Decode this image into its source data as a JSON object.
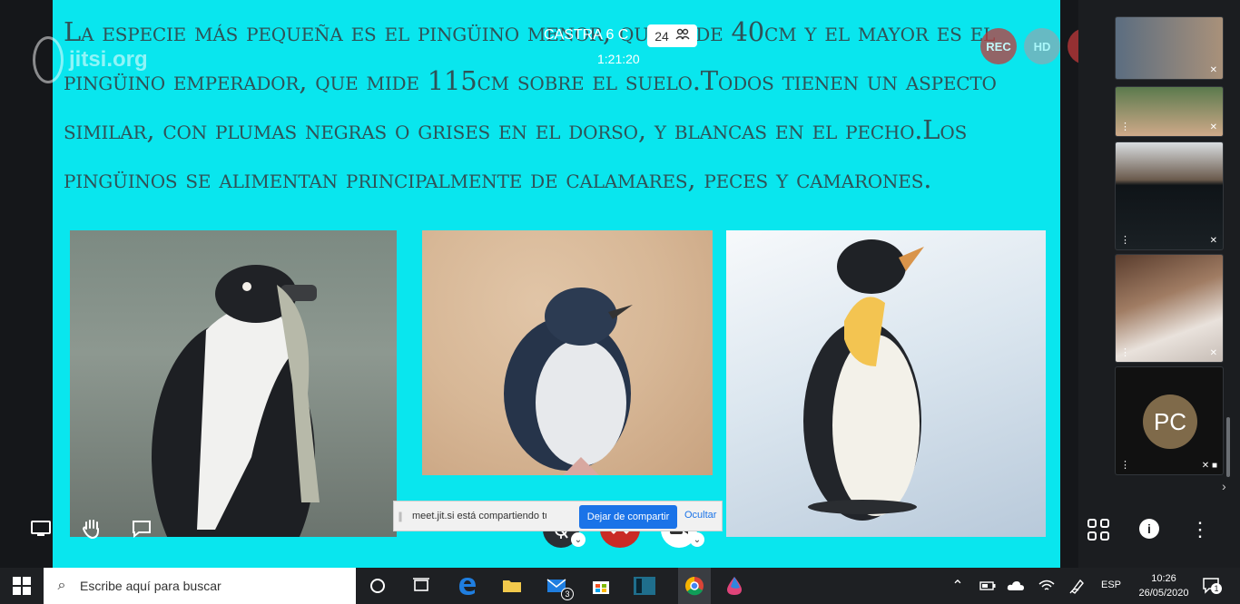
{
  "meeting": {
    "title": "CASTRA 6 C",
    "participant_count": "24",
    "timer": "1:21:20",
    "watermark": "jitsi.org",
    "rec_label": "REC",
    "hd_label": "HD"
  },
  "slide": {
    "text": "La especie más pequeña es el pingüino menor, que mide 40cm y el mayor es el pingüino emperador, que mide 115cm sobre el suelo.Todos tienen un aspecto similar, con plumas negras o grises en el dorso, y blancas en el pecho.Los pingüinos se alimentan principalmente de calamares, peces y camarones.",
    "images": [
      "humboldt-penguin-with-fish",
      "little-penguin-on-sand",
      "emperor-penguin-on-snow"
    ]
  },
  "share_notice": {
    "text": "meet.jit.si está compartiendo tu pantalla.",
    "stop_label": "Dejar de compartir",
    "hide_label": "Ocultar"
  },
  "filmstrip": {
    "tiles": [
      {
        "name": "participant-1",
        "muted": true
      },
      {
        "name": "participant-2",
        "muted": true
      },
      {
        "name": "participant-3",
        "muted": true
      },
      {
        "name": "participant-4",
        "muted": true
      },
      {
        "name": "participant-pc",
        "initials": "PC",
        "muted": true
      }
    ]
  },
  "toolbar": {
    "icons": [
      "desktop-icon",
      "hand-icon",
      "chat-icon",
      "mic-off-icon",
      "hangup-icon",
      "camera-icon",
      "tile-view-icon",
      "info-icon",
      "more-icon"
    ]
  },
  "taskbar": {
    "search_placeholder": "Escribe aquí para buscar",
    "mail_badge": "3",
    "language": "ESP",
    "time": "10:26",
    "date": "26/05/2020",
    "notification_count": "1"
  },
  "colors": {
    "slide_bg": "#09e6ee",
    "hangup": "#c92a26",
    "stop_sharing": "#1a73e8"
  }
}
